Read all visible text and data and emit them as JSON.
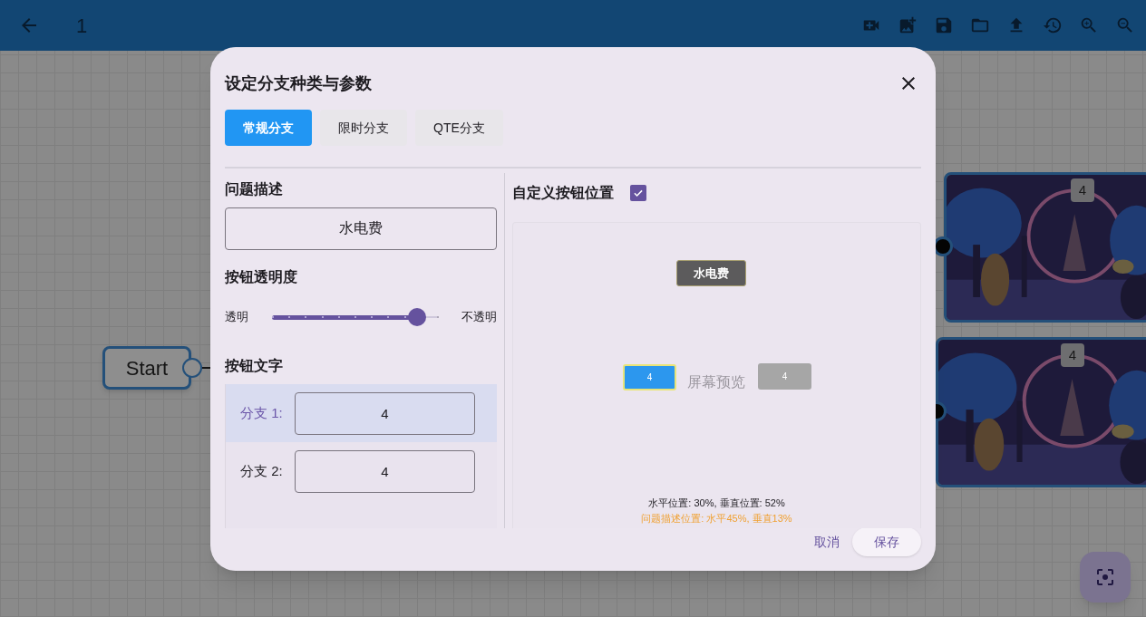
{
  "app_bar": {
    "title": "1"
  },
  "canvas": {
    "nodes": [
      {
        "kind": "start",
        "label": "Start"
      },
      {
        "kind": "picture",
        "badge": "4"
      },
      {
        "kind": "picture",
        "badge": "4"
      }
    ]
  },
  "dialog": {
    "title": "设定分支种类与参数",
    "tabs": [
      {
        "label": "常规分支",
        "selected": true
      },
      {
        "label": "限时分支",
        "selected": false
      },
      {
        "label": "QTE分支",
        "selected": false
      }
    ],
    "question": {
      "heading": "问题描述",
      "value": "水电费"
    },
    "opacity": {
      "heading": "按钮透明度",
      "min_label": "透明",
      "max_label": "不透明",
      "level": 0.88
    },
    "branch_text": {
      "heading": "按钮文字",
      "branches": [
        {
          "label": "分支 1:",
          "value": "4",
          "selected": true
        },
        {
          "label": "分支 2:",
          "value": "4",
          "selected": false
        }
      ]
    },
    "custom_position": {
      "label": "自定义按钮位置",
      "checked": true
    },
    "preview": {
      "question": "水电费",
      "caption": "屏幕预览",
      "buttons": [
        {
          "label": "4",
          "selected": true
        },
        {
          "label": "4",
          "selected": false
        }
      ],
      "position": "水平位置: 30%, 垂直位置: 52%",
      "question_position": "问题描述位置: 水平45%, 垂直13%"
    },
    "actions": [
      {
        "label": "取消",
        "kind": "text"
      },
      {
        "label": "保存",
        "kind": "filled"
      }
    ]
  }
}
